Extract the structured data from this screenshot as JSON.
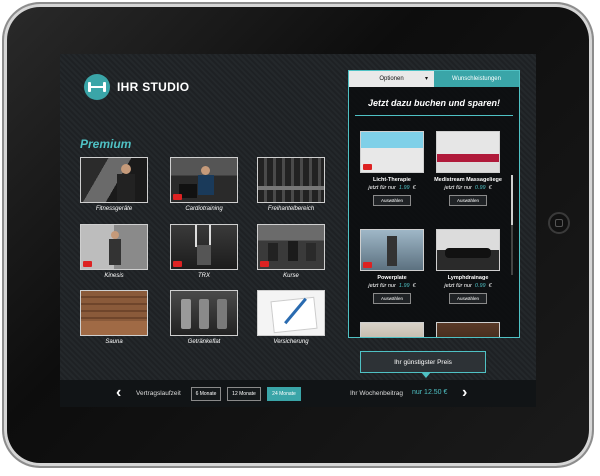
{
  "brand": {
    "name": "IHR STUDIO"
  },
  "section_title": "Premium",
  "tiles": [
    {
      "label": "Fitnessgeräte",
      "video": false
    },
    {
      "label": "Cardiotraining",
      "video": true
    },
    {
      "label": "Freihantelbereich",
      "video": false
    },
    {
      "label": "Kinesis",
      "video": true
    },
    {
      "label": "TRX",
      "video": true
    },
    {
      "label": "Kurse",
      "video": true
    },
    {
      "label": "Sauna",
      "video": false
    },
    {
      "label": "Getränkeflat",
      "video": false
    },
    {
      "label": "Versicherung",
      "video": false
    }
  ],
  "panel": {
    "tab_options": "Optionen",
    "tab_wishes": "Wunschleistungen",
    "headline": "Jetzt dazu buchen und sparen!",
    "price_prefix": "jetzt für nur",
    "currency": "€",
    "select_label": "Auswählen",
    "addons": [
      {
        "name": "Licht-Therapie",
        "price": "1.99"
      },
      {
        "name": "Medistream Massageliege",
        "price": "0.99"
      },
      {
        "name": "Powerplate",
        "price": "1.99"
      },
      {
        "name": "Lymphdrainage",
        "price": "0.99"
      }
    ]
  },
  "tooltip": "Ihr günstigster Preis",
  "bottom": {
    "term_label": "Vertragslaufzeit",
    "terms": [
      {
        "label": "6 Monate",
        "active": false
      },
      {
        "label": "12 Monate",
        "active": false
      },
      {
        "label": "24 Monate",
        "active": true
      }
    ],
    "weekly_label": "Ihr Wochenbeitrag",
    "weekly_value": "nur 12.50 €"
  },
  "colors": {
    "accent": "#3aa5a8",
    "accent_light": "#4fc1c4",
    "screen_bg": "#1e2124"
  }
}
